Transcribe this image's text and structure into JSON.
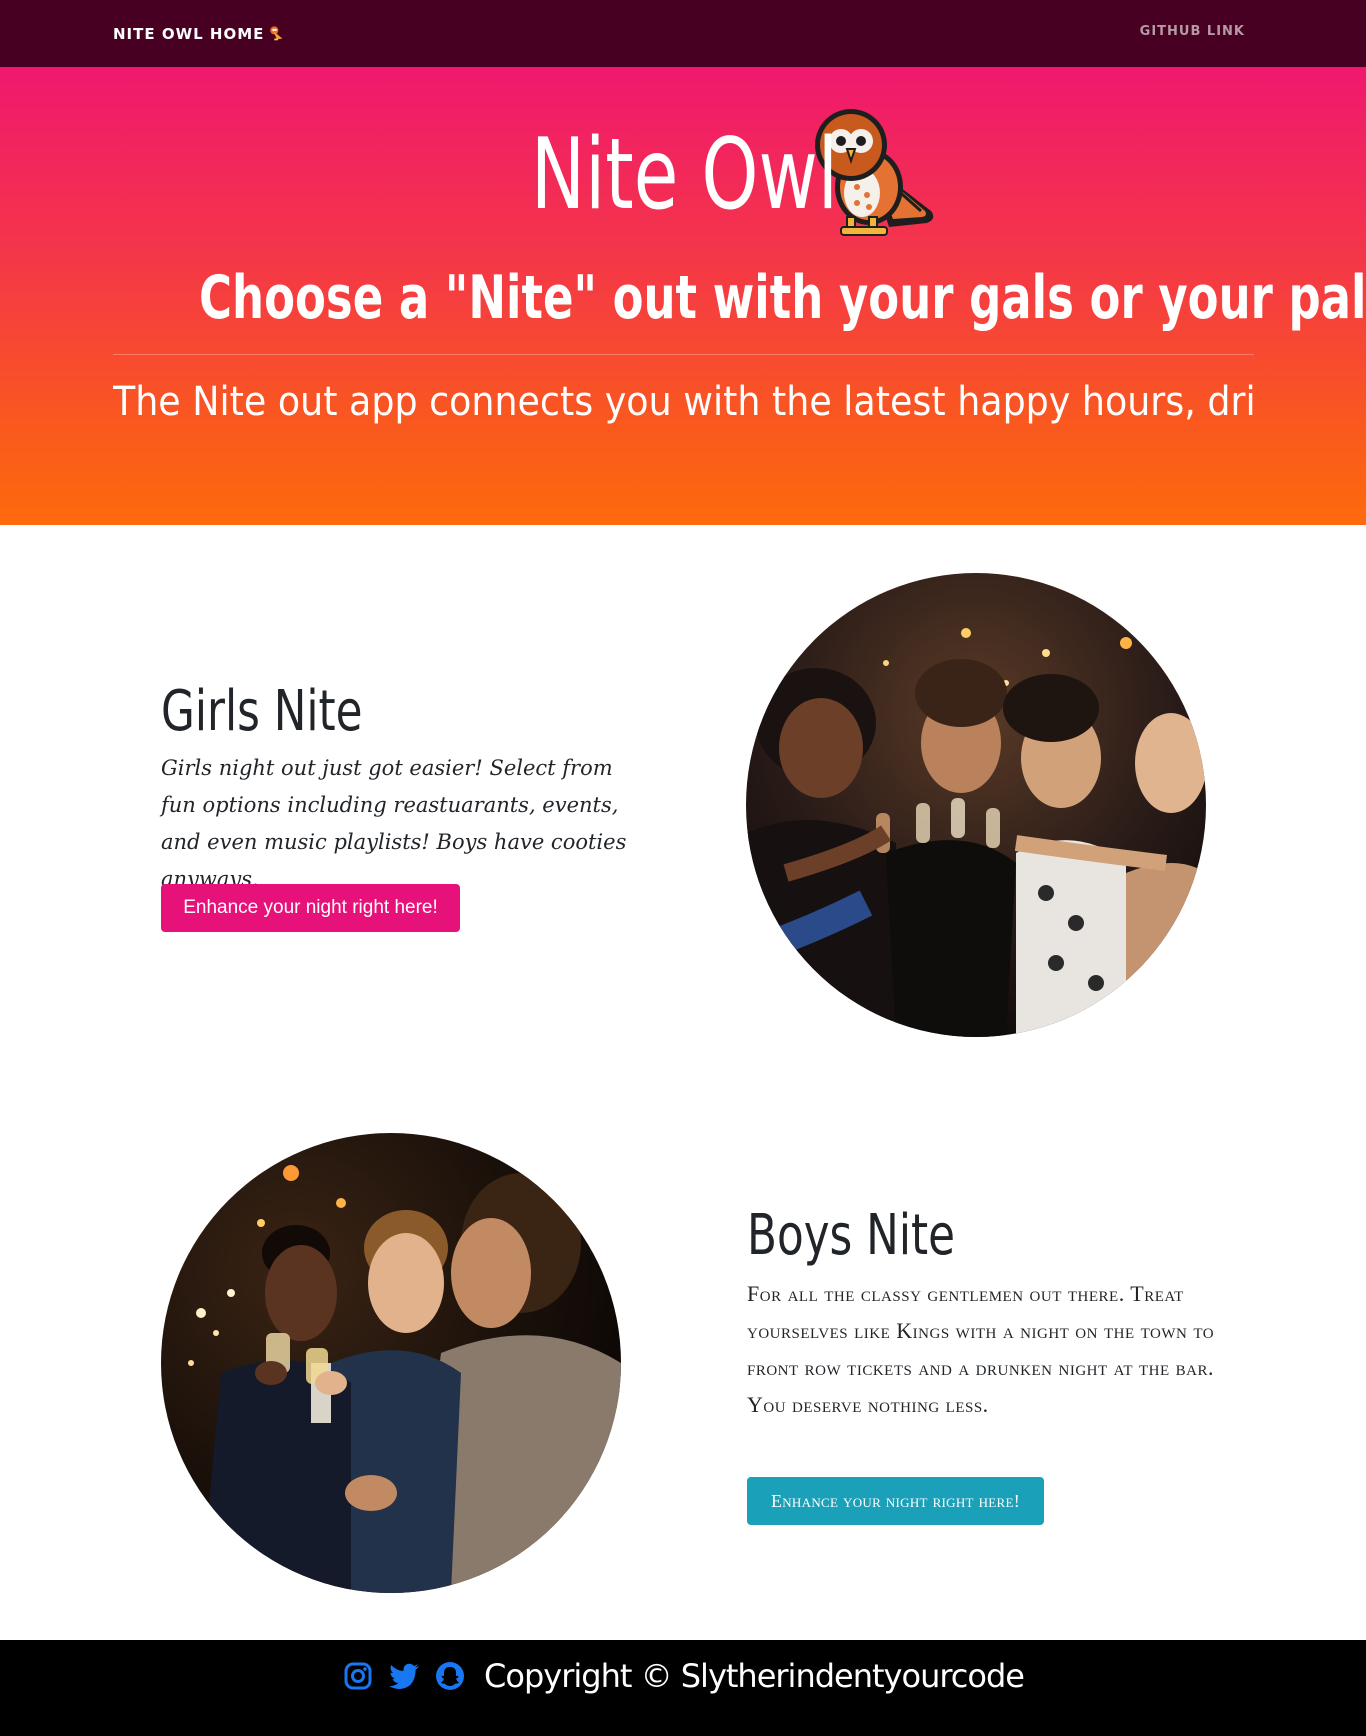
{
  "navbar": {
    "brand": "NITE OWL HOME",
    "brand_icon": "owl-icon",
    "github_link": "GITHUB LINK"
  },
  "hero": {
    "title": "Nite Owl",
    "title_icon": "owl-icon",
    "subtitle": "Choose a \"Nite\" out with your gals or your pals",
    "tagline": "The Nite out app connects you with the latest happy hours, drink s"
  },
  "girls": {
    "heading": "Girls Nite",
    "text": "Girls night out just got easier! Select from fun options including reastuarants, events, and even music playlists! Boys have cooties anyways.",
    "button": "Enhance your night right here!",
    "button_color": "#e6127a"
  },
  "boys": {
    "heading": "Boys Nite",
    "text": "For all the classy gentlemen out there. Treat yourselves like Kings with a night on the town to front row tickets and a drunken night at the bar. You deserve nothing less.",
    "button": "Enhance your night right here!",
    "button_color": "#1aa0b8"
  },
  "footer": {
    "icons": [
      "instagram-icon",
      "twitter-icon",
      "snapchat-icon"
    ],
    "icon_color": "#1877f2",
    "copyright": "Copyright © Slytherindentyourcode"
  },
  "colors": {
    "navbar_bg": "#470021",
    "hero_gradient_top": "#f0186e",
    "hero_gradient_bottom": "#fe6a0c",
    "footer_bg": "#000000"
  }
}
